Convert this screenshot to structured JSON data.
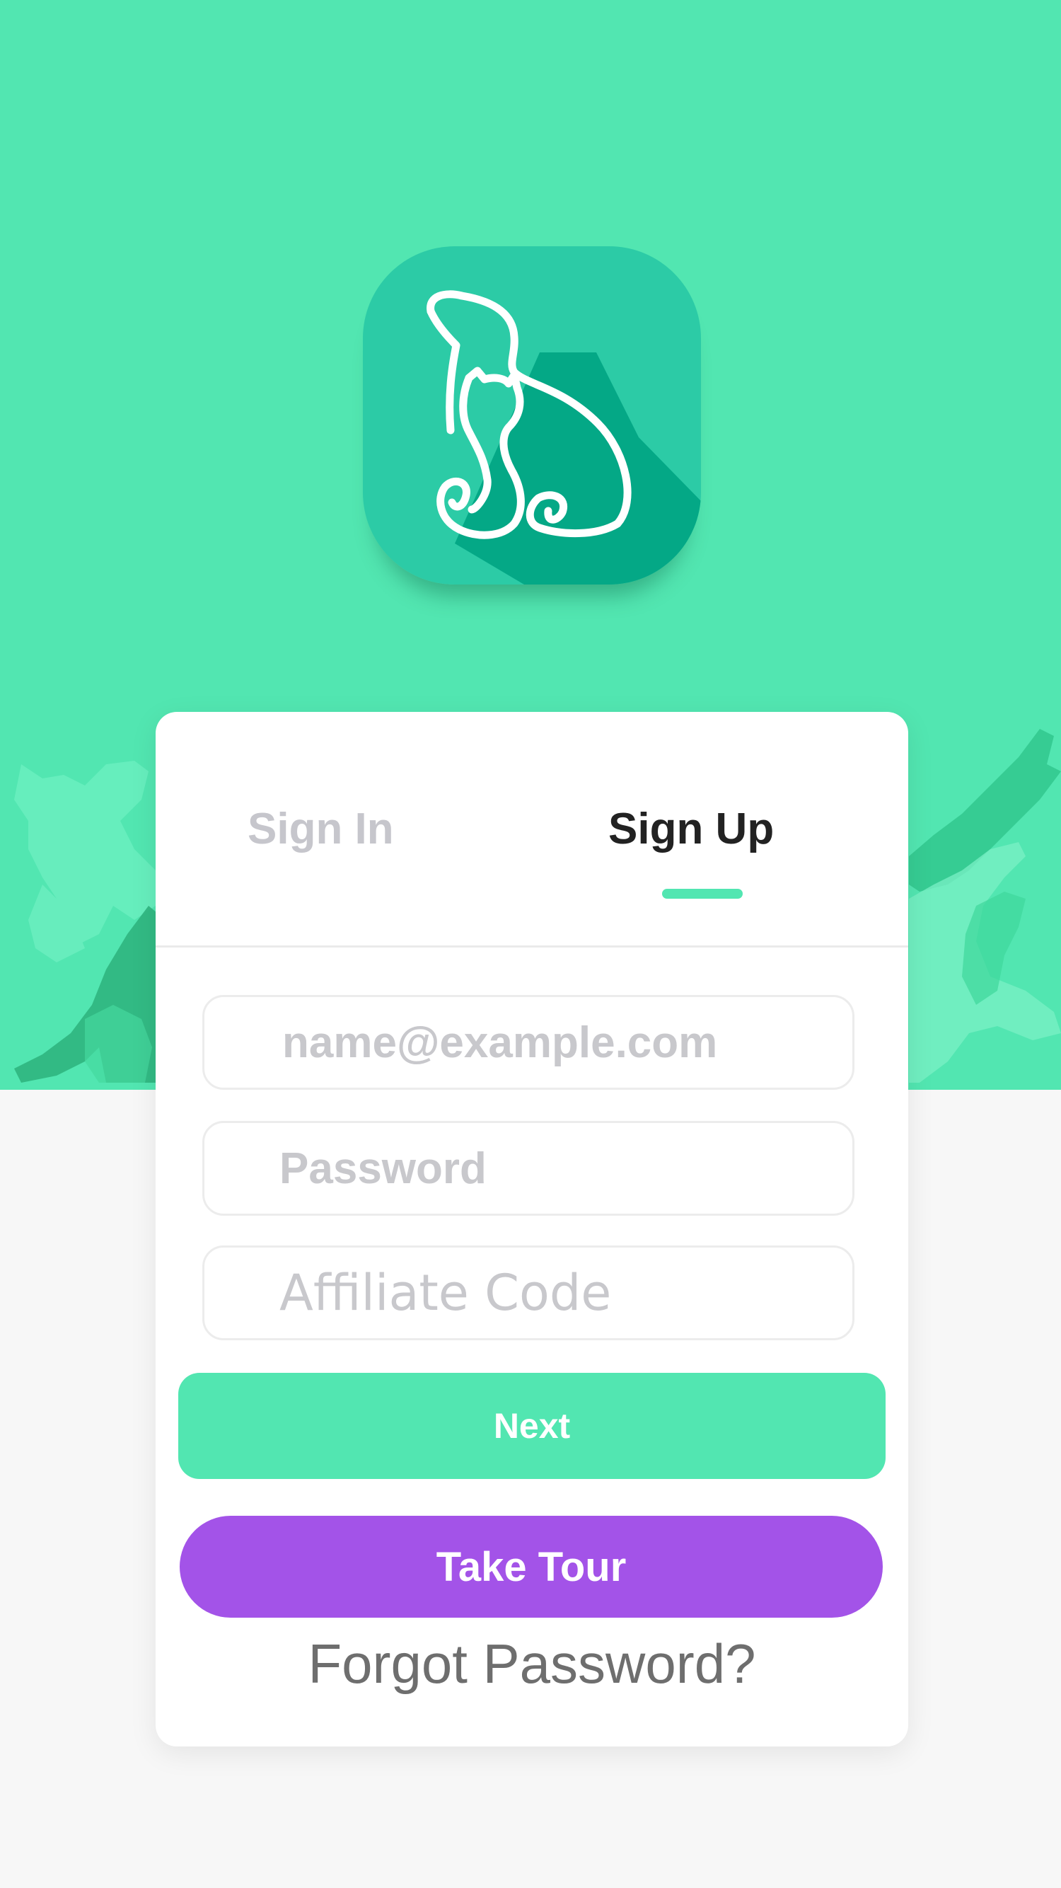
{
  "colors": {
    "brand_green": "#52e6b1",
    "icon_teal": "#2ccba6",
    "icon_shadow_teal": "#04a886",
    "accent_purple": "#a353e8",
    "background": "#f7f7f7"
  },
  "logo": {
    "icon": "dog-and-cat-logo-icon"
  },
  "tabs": {
    "sign_in": "Sign In",
    "sign_up": "Sign Up",
    "active": "sign_up"
  },
  "form": {
    "email_placeholder": "name@example.com",
    "password_placeholder": "Password",
    "affiliate_placeholder": "Affiliate Code"
  },
  "buttons": {
    "next": "Next",
    "take_tour": "Take Tour"
  },
  "links": {
    "forgot_password": "Forgot Password?"
  }
}
